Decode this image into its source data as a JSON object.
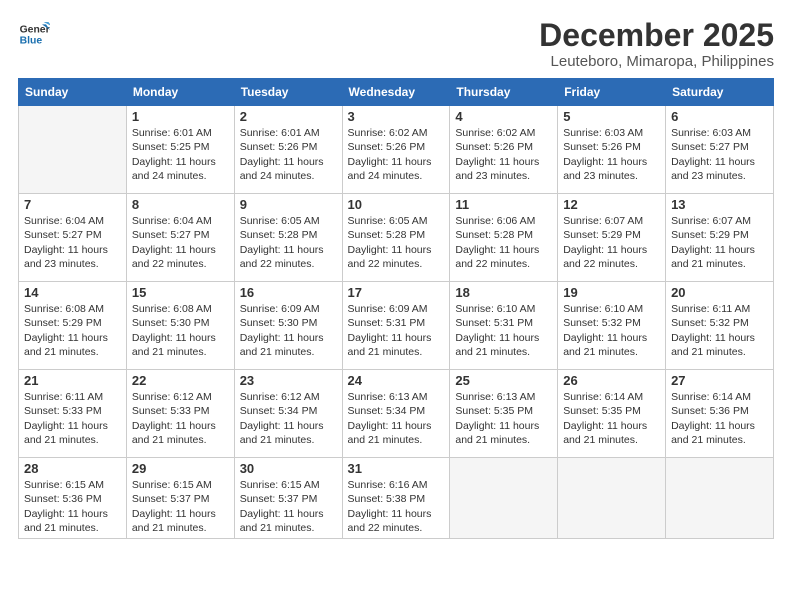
{
  "logo": {
    "line1": "General",
    "line2": "Blue"
  },
  "title": "December 2025",
  "subtitle": "Leuteboro, Mimaropa, Philippines",
  "headers": [
    "Sunday",
    "Monday",
    "Tuesday",
    "Wednesday",
    "Thursday",
    "Friday",
    "Saturday"
  ],
  "weeks": [
    [
      {
        "date": "",
        "content": ""
      },
      {
        "date": "1",
        "content": "Sunrise: 6:01 AM\nSunset: 5:25 PM\nDaylight: 11 hours\nand 24 minutes."
      },
      {
        "date": "2",
        "content": "Sunrise: 6:01 AM\nSunset: 5:26 PM\nDaylight: 11 hours\nand 24 minutes."
      },
      {
        "date": "3",
        "content": "Sunrise: 6:02 AM\nSunset: 5:26 PM\nDaylight: 11 hours\nand 24 minutes."
      },
      {
        "date": "4",
        "content": "Sunrise: 6:02 AM\nSunset: 5:26 PM\nDaylight: 11 hours\nand 23 minutes."
      },
      {
        "date": "5",
        "content": "Sunrise: 6:03 AM\nSunset: 5:26 PM\nDaylight: 11 hours\nand 23 minutes."
      },
      {
        "date": "6",
        "content": "Sunrise: 6:03 AM\nSunset: 5:27 PM\nDaylight: 11 hours\nand 23 minutes."
      }
    ],
    [
      {
        "date": "7",
        "content": "Sunrise: 6:04 AM\nSunset: 5:27 PM\nDaylight: 11 hours\nand 23 minutes."
      },
      {
        "date": "8",
        "content": "Sunrise: 6:04 AM\nSunset: 5:27 PM\nDaylight: 11 hours\nand 22 minutes."
      },
      {
        "date": "9",
        "content": "Sunrise: 6:05 AM\nSunset: 5:28 PM\nDaylight: 11 hours\nand 22 minutes."
      },
      {
        "date": "10",
        "content": "Sunrise: 6:05 AM\nSunset: 5:28 PM\nDaylight: 11 hours\nand 22 minutes."
      },
      {
        "date": "11",
        "content": "Sunrise: 6:06 AM\nSunset: 5:28 PM\nDaylight: 11 hours\nand 22 minutes."
      },
      {
        "date": "12",
        "content": "Sunrise: 6:07 AM\nSunset: 5:29 PM\nDaylight: 11 hours\nand 22 minutes."
      },
      {
        "date": "13",
        "content": "Sunrise: 6:07 AM\nSunset: 5:29 PM\nDaylight: 11 hours\nand 21 minutes."
      }
    ],
    [
      {
        "date": "14",
        "content": "Sunrise: 6:08 AM\nSunset: 5:29 PM\nDaylight: 11 hours\nand 21 minutes."
      },
      {
        "date": "15",
        "content": "Sunrise: 6:08 AM\nSunset: 5:30 PM\nDaylight: 11 hours\nand 21 minutes."
      },
      {
        "date": "16",
        "content": "Sunrise: 6:09 AM\nSunset: 5:30 PM\nDaylight: 11 hours\nand 21 minutes."
      },
      {
        "date": "17",
        "content": "Sunrise: 6:09 AM\nSunset: 5:31 PM\nDaylight: 11 hours\nand 21 minutes."
      },
      {
        "date": "18",
        "content": "Sunrise: 6:10 AM\nSunset: 5:31 PM\nDaylight: 11 hours\nand 21 minutes."
      },
      {
        "date": "19",
        "content": "Sunrise: 6:10 AM\nSunset: 5:32 PM\nDaylight: 11 hours\nand 21 minutes."
      },
      {
        "date": "20",
        "content": "Sunrise: 6:11 AM\nSunset: 5:32 PM\nDaylight: 11 hours\nand 21 minutes."
      }
    ],
    [
      {
        "date": "21",
        "content": "Sunrise: 6:11 AM\nSunset: 5:33 PM\nDaylight: 11 hours\nand 21 minutes."
      },
      {
        "date": "22",
        "content": "Sunrise: 6:12 AM\nSunset: 5:33 PM\nDaylight: 11 hours\nand 21 minutes."
      },
      {
        "date": "23",
        "content": "Sunrise: 6:12 AM\nSunset: 5:34 PM\nDaylight: 11 hours\nand 21 minutes."
      },
      {
        "date": "24",
        "content": "Sunrise: 6:13 AM\nSunset: 5:34 PM\nDaylight: 11 hours\nand 21 minutes."
      },
      {
        "date": "25",
        "content": "Sunrise: 6:13 AM\nSunset: 5:35 PM\nDaylight: 11 hours\nand 21 minutes."
      },
      {
        "date": "26",
        "content": "Sunrise: 6:14 AM\nSunset: 5:35 PM\nDaylight: 11 hours\nand 21 minutes."
      },
      {
        "date": "27",
        "content": "Sunrise: 6:14 AM\nSunset: 5:36 PM\nDaylight: 11 hours\nand 21 minutes."
      }
    ],
    [
      {
        "date": "28",
        "content": "Sunrise: 6:15 AM\nSunset: 5:36 PM\nDaylight: 11 hours\nand 21 minutes."
      },
      {
        "date": "29",
        "content": "Sunrise: 6:15 AM\nSunset: 5:37 PM\nDaylight: 11 hours\nand 21 minutes."
      },
      {
        "date": "30",
        "content": "Sunrise: 6:15 AM\nSunset: 5:37 PM\nDaylight: 11 hours\nand 21 minutes."
      },
      {
        "date": "31",
        "content": "Sunrise: 6:16 AM\nSunset: 5:38 PM\nDaylight: 11 hours\nand 22 minutes."
      },
      {
        "date": "",
        "content": ""
      },
      {
        "date": "",
        "content": ""
      },
      {
        "date": "",
        "content": ""
      }
    ]
  ]
}
